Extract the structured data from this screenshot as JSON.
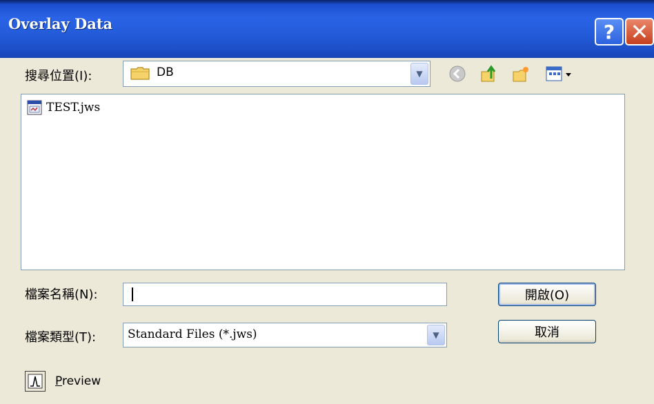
{
  "window": {
    "title": "Overlay Data",
    "help_glyph": "?",
    "close_glyph": "✕"
  },
  "lookin": {
    "label": "搜尋位置(I):",
    "value": "DB",
    "icon": "folder-icon"
  },
  "toolbar": {
    "icons": [
      "back-icon",
      "up-folder-icon",
      "new-folder-icon",
      "view-menu-icon"
    ]
  },
  "files": [
    {
      "name": "TEST.jws",
      "icon": "jws-file-icon"
    }
  ],
  "filename": {
    "label": "檔案名稱(N):",
    "value": ""
  },
  "filetype": {
    "label": "檔案類型(T):",
    "value": "Standard Files (*.jws)"
  },
  "buttons": {
    "open": "開啟(O)",
    "cancel": "取消"
  },
  "preview": {
    "label_first": "P",
    "label_rest": "review",
    "checked": false
  },
  "colors": {
    "titlebar": "#245ddb",
    "dialog_bg": "#ece9d8",
    "border": "#7f9db9"
  }
}
